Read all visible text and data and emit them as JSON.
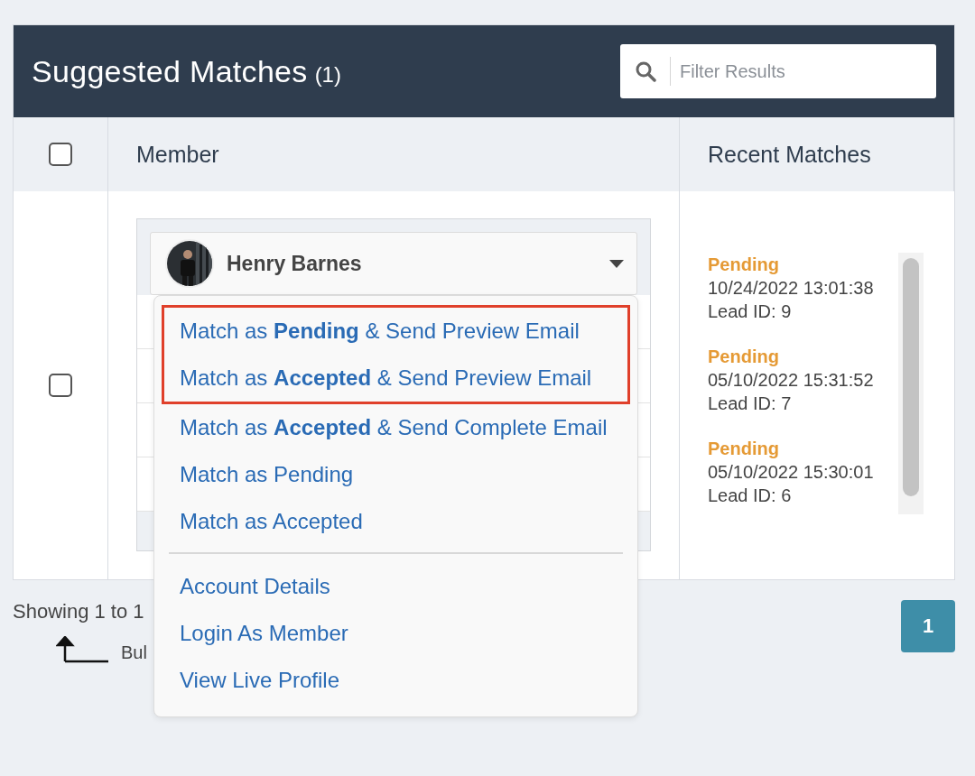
{
  "panel": {
    "title": "Suggested Matches",
    "count": "(1)",
    "filter": {
      "placeholder": "Filter Results"
    }
  },
  "table": {
    "select_all": {
      "checked": false
    },
    "columns": [
      "Member",
      "Recent Matches"
    ],
    "rows": [
      {
        "checked": false,
        "member": {
          "name": "Henry Barnes"
        },
        "recent_matches": [
          {
            "status": "Pending",
            "date": "10/24/2022 13:01:38",
            "lead": "Lead ID: 9"
          },
          {
            "status": "Pending",
            "date": "05/10/2022 15:31:52",
            "lead": "Lead ID: 7"
          },
          {
            "status": "Pending",
            "date": "05/10/2022 15:30:01",
            "lead": "Lead ID: 6"
          }
        ]
      }
    ]
  },
  "menu": {
    "groups": [
      {
        "items": [
          {
            "label": "Match as **Pending** & Send Preview Email",
            "highlighted": true
          },
          {
            "label": "Match as **Accepted** & Send Preview Email",
            "highlighted": true
          },
          {
            "label": "Match as **Accepted** & Send Complete Email",
            "highlighted": false
          },
          {
            "label": "Match as Pending",
            "highlighted": false
          },
          {
            "label": "Match as Accepted",
            "highlighted": false
          }
        ]
      },
      {
        "items": [
          {
            "label": "Account Details",
            "highlighted": false
          },
          {
            "label": "Login As Member",
            "highlighted": false
          },
          {
            "label": "View Live Profile",
            "highlighted": false
          }
        ]
      }
    ]
  },
  "footer": {
    "showing": "Showing 1 to 1",
    "bulk_label": "Bul",
    "pages": [
      {
        "label": "1",
        "selected": true
      }
    ]
  }
}
